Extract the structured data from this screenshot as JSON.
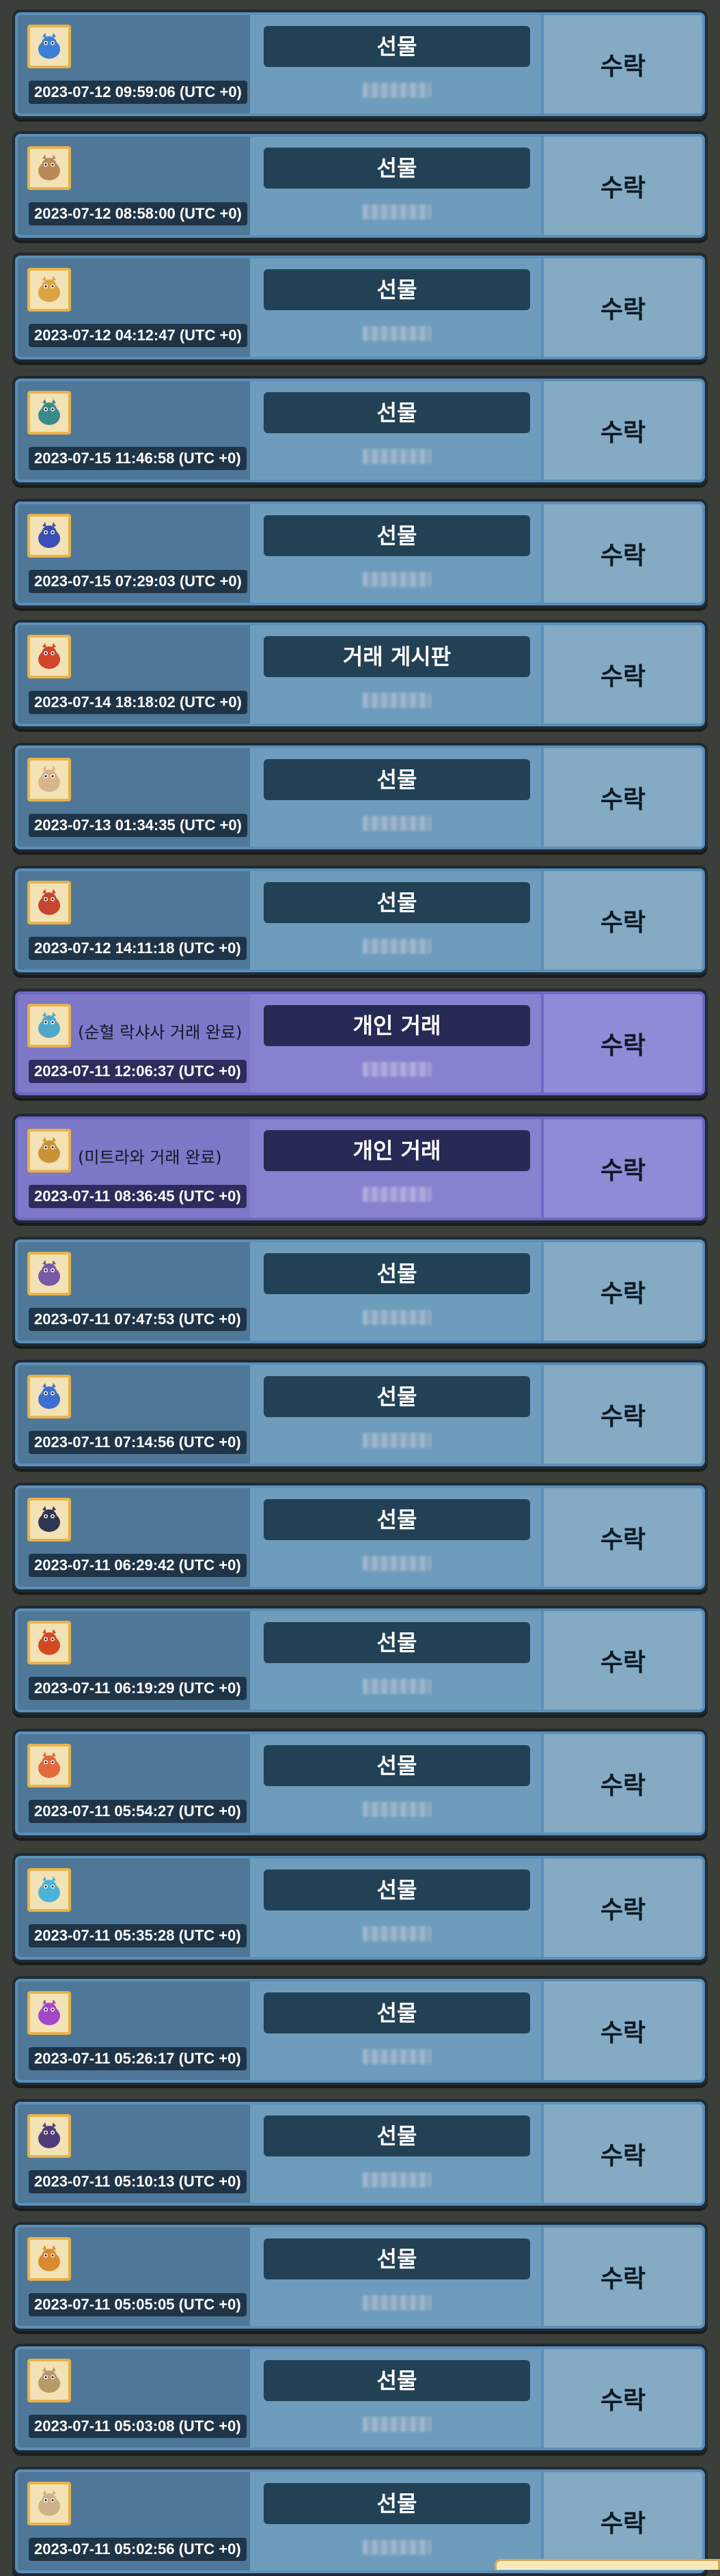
{
  "accept_label": "수락",
  "rows": [
    {
      "type": "선물",
      "timestamp": "2023-07-12 09:59:06 (UTC +0)",
      "partner": "",
      "private": false,
      "icon": "blue-creature-icon",
      "color": "#3d7fd6"
    },
    {
      "type": "선물",
      "timestamp": "2023-07-12 08:58:00 (UTC +0)",
      "partner": "",
      "private": false,
      "icon": "rabbit-creature-icon",
      "color": "#b98a55"
    },
    {
      "type": "선물",
      "timestamp": "2023-07-12 04:12:47 (UTC +0)",
      "partner": "",
      "private": false,
      "icon": "egg-icon",
      "color": "#d9a441"
    },
    {
      "type": "선물",
      "timestamp": "2023-07-15 11:46:58 (UTC +0)",
      "partner": "",
      "private": false,
      "icon": "teal-creature-icon",
      "color": "#3b8a8c"
    },
    {
      "type": "선물",
      "timestamp": "2023-07-15 07:29:03 (UTC +0)",
      "partner": "",
      "private": false,
      "icon": "blue-dragon-icon",
      "color": "#3a4fb3"
    },
    {
      "type": "거래 게시판",
      "timestamp": "2023-07-14 18:18:02 (UTC +0)",
      "partner": "",
      "private": false,
      "icon": "red-creature-icon",
      "color": "#d2452b"
    },
    {
      "type": "선물",
      "timestamp": "2023-07-13 01:34:35 (UTC +0)",
      "partner": "",
      "private": false,
      "icon": "cream-creature-icon",
      "color": "#d8b48a"
    },
    {
      "type": "선물",
      "timestamp": "2023-07-12 14:11:18 (UTC +0)",
      "partner": "",
      "private": false,
      "icon": "red-blue-creature-icon",
      "color": "#c8452e"
    },
    {
      "type": "개인 거래",
      "timestamp": "2023-07-11 12:06:37 (UTC +0)",
      "partner": "(순혈 락샤사 거래 완료)",
      "private": true,
      "icon": "crystal-creature-icon",
      "color": "#4fa8c8"
    },
    {
      "type": "개인 거래",
      "timestamp": "2023-07-11 08:36:45 (UTC +0)",
      "partner": "(미트라와 거래 완료)",
      "private": true,
      "icon": "golden-creature-icon",
      "color": "#c99335"
    },
    {
      "type": "선물",
      "timestamp": "2023-07-11 07:47:53 (UTC +0)",
      "partner": "",
      "private": false,
      "icon": "purple-creature-icon",
      "color": "#7a5aa8"
    },
    {
      "type": "선물",
      "timestamp": "2023-07-11 07:14:56 (UTC +0)",
      "partner": "",
      "private": false,
      "icon": "blue-spirit-icon",
      "color": "#3e6fd0"
    },
    {
      "type": "선물",
      "timestamp": "2023-07-11 06:29:42 (UTC +0)",
      "partner": "",
      "private": false,
      "icon": "dark-beast-icon",
      "color": "#2f3450"
    },
    {
      "type": "선물",
      "timestamp": "2023-07-11 06:19:29 (UTC +0)",
      "partner": "",
      "private": false,
      "icon": "fire-creature-icon",
      "color": "#d24a22"
    },
    {
      "type": "선물",
      "timestamp": "2023-07-11 05:54:27 (UTC +0)",
      "partner": "",
      "private": false,
      "icon": "fox-creature-icon",
      "color": "#e06a3a"
    },
    {
      "type": "선물",
      "timestamp": "2023-07-11 05:35:28 (UTC +0)",
      "partner": "",
      "private": false,
      "icon": "water-creature-icon",
      "color": "#4bb3d6"
    },
    {
      "type": "선물",
      "timestamp": "2023-07-11 05:26:17 (UTC +0)",
      "partner": "",
      "private": false,
      "icon": "purple-egg-icon",
      "color": "#a347c9"
    },
    {
      "type": "선물",
      "timestamp": "2023-07-11 05:10:13 (UTC +0)",
      "partner": "",
      "private": false,
      "icon": "dark-purple-creature-icon",
      "color": "#4e3d78"
    },
    {
      "type": "선물",
      "timestamp": "2023-07-11 05:05:05 (UTC +0)",
      "partner": "",
      "private": false,
      "icon": "orange-creature-icon",
      "color": "#d88a2c"
    },
    {
      "type": "선물",
      "timestamp": "2023-07-11 05:03:08 (UTC +0)",
      "partner": "",
      "private": false,
      "icon": "tan-creature-icon",
      "color": "#b89a6a"
    },
    {
      "type": "선물",
      "timestamp": "2023-07-11 05:02:56 (UTC +0)",
      "partner": "",
      "private": false,
      "icon": "beige-creature-icon",
      "color": "#cdb28a"
    }
  ]
}
